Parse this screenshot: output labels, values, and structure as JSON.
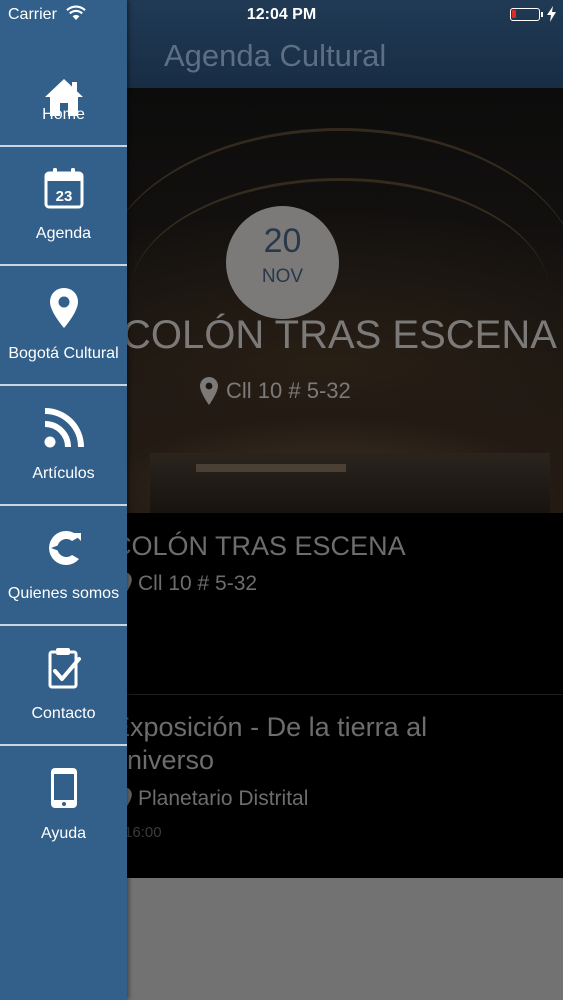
{
  "status_bar": {
    "carrier": "Carrier",
    "time": "12:04 PM",
    "battery_level": 0.15,
    "battery_color": "#e02a2a"
  },
  "navbar": {
    "title": "Agenda Cultural"
  },
  "featured": {
    "day": "20",
    "month": "NOV",
    "title": "COLÓN TRAS ESCENA",
    "location": "Cll 10 # 5-32",
    "location_icon": "map-pin-icon"
  },
  "events": [
    {
      "title": "COLÓN TRAS ESCENA",
      "location": "Cll 10 # 5-32",
      "location_icon": "map-pin-icon"
    },
    {
      "title_line1": "Exposición - De la tierra al",
      "title_line2": "universo",
      "location": "Planetario Distrital",
      "time": "16:00",
      "location_icon": "map-pin-icon"
    }
  ],
  "menu": {
    "accent_color": "#32608a",
    "items": [
      {
        "label": "Home",
        "icon": "home-icon"
      },
      {
        "label": "Agenda",
        "icon": "calendar-icon",
        "icon_text": "23"
      },
      {
        "label": "Bogotá Cultural",
        "icon": "map-pin-icon"
      },
      {
        "label": "Artículos",
        "icon": "rss-icon"
      },
      {
        "label": "Quienes somos",
        "icon": "logo-c-icon"
      },
      {
        "label": "Contacto",
        "icon": "clipboard-check-icon"
      },
      {
        "label": "Ayuda",
        "icon": "smartphone-icon"
      }
    ]
  }
}
